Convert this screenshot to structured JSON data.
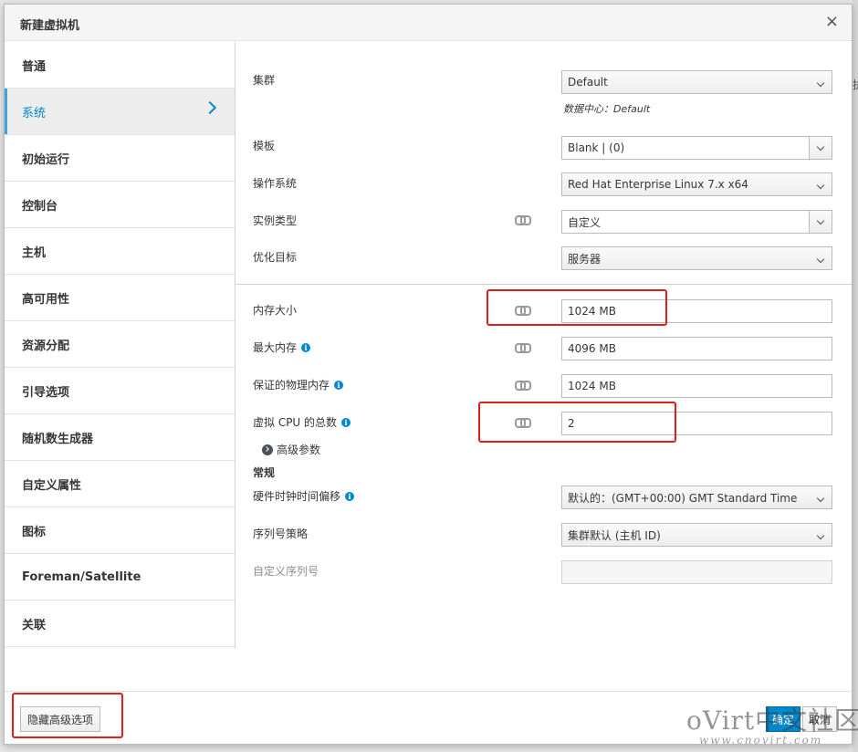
{
  "dialog": {
    "title": "新建虚拟机",
    "close_label": "×"
  },
  "sidebar": {
    "items": [
      {
        "label": "普通"
      },
      {
        "label": "系统"
      },
      {
        "label": "初始运行"
      },
      {
        "label": "控制台"
      },
      {
        "label": "主机"
      },
      {
        "label": "高可用性"
      },
      {
        "label": "资源分配"
      },
      {
        "label": "引导选项"
      },
      {
        "label": "随机数生成器"
      },
      {
        "label": "自定义属性"
      },
      {
        "label": "图标"
      },
      {
        "label": "Foreman/Satellite"
      },
      {
        "label": "关联"
      }
    ],
    "active_index": 1
  },
  "form": {
    "cluster": {
      "label": "集群",
      "value": "Default",
      "note": "数据中心：Default"
    },
    "template": {
      "label": "模板",
      "value": "Blank |  (0)"
    },
    "os": {
      "label": "操作系统",
      "value": "Red Hat Enterprise Linux 7.x x64"
    },
    "instance_type": {
      "label": "实例类型",
      "value": "自定义"
    },
    "optimize": {
      "label": "优化目标",
      "value": "服务器"
    },
    "memory": {
      "label": "内存大小",
      "value": "1024 MB"
    },
    "max_memory": {
      "label": "最大内存",
      "value": "4096 MB"
    },
    "guaranteed_memory": {
      "label": "保证的物理内存",
      "value": "1024 MB"
    },
    "vcpu": {
      "label": "虚拟 CPU 的总数",
      "value": "2"
    },
    "advanced_params": {
      "label": "高级参数"
    },
    "general_section": {
      "label": "常规"
    },
    "hw_clock": {
      "label": "硬件时钟时间偏移",
      "value": "默认的：(GMT+00:00) GMT Standard Time"
    },
    "serial_policy": {
      "label": "序列号策略",
      "value": "集群默认 (主机 ID)"
    },
    "custom_serial": {
      "label": "自定义序列号",
      "value": ""
    }
  },
  "footer": {
    "hide_advanced_label": "隐藏高级选项",
    "ok_label": "确定",
    "cancel_label": "取消"
  },
  "watermark": {
    "text": "oVirt中文社区",
    "url": "www.cnovirt.com"
  },
  "backdrop": {
    "glyph": "执"
  },
  "colors": {
    "accent": "#0088ce",
    "highlight": "#e0201a",
    "active_bg": "#ededed"
  },
  "icons": {
    "info": "info-icon",
    "link": "link-icon",
    "close": "close-icon"
  }
}
